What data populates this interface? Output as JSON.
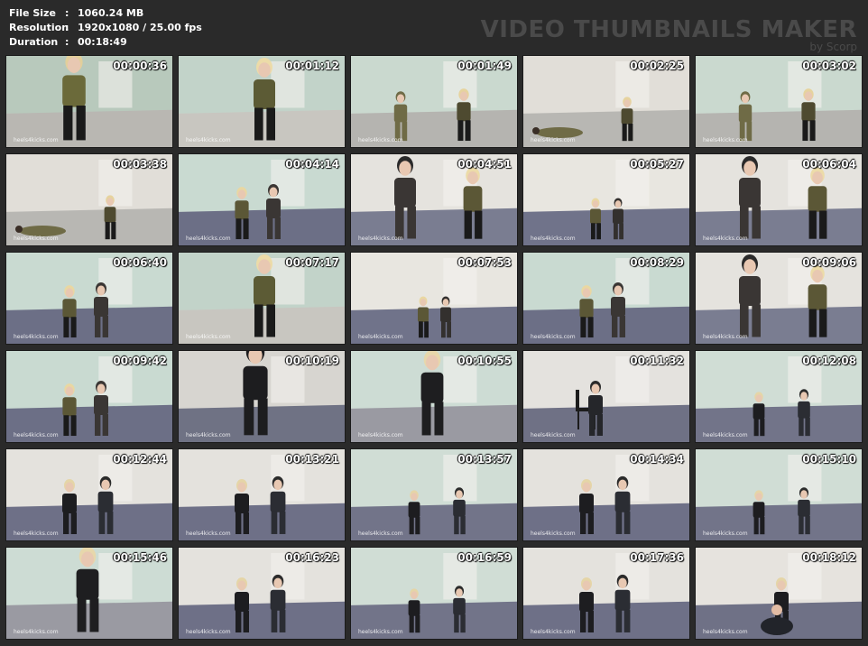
{
  "header": {
    "file_size_label": "File Size",
    "file_size_value": "1060.24 MB",
    "resolution_label": "Resolution",
    "resolution_value": "1920x1080 / 25.00 fps",
    "duration_label": "Duration",
    "duration_value": "00:18:49",
    "separator": ":",
    "brand_title": "VIDEO THUMBNAILS MAKER",
    "brand_sub": "by Scorp"
  },
  "watermark": "heels4kicks.com",
  "thumbnails": [
    {
      "time": "00:00:36",
      "scene": "camo-close"
    },
    {
      "time": "00:01:12",
      "scene": "camo-portrait"
    },
    {
      "time": "00:01:49",
      "scene": "camo-two"
    },
    {
      "time": "00:02:25",
      "scene": "camo-floor"
    },
    {
      "time": "00:03:02",
      "scene": "camo-two"
    },
    {
      "time": "00:03:38",
      "scene": "camo-floor"
    },
    {
      "time": "00:04:14",
      "scene": "suit-two"
    },
    {
      "time": "00:04:51",
      "scene": "suit-close"
    },
    {
      "time": "00:05:27",
      "scene": "suit-far"
    },
    {
      "time": "00:06:04",
      "scene": "suit-close"
    },
    {
      "time": "00:06:40",
      "scene": "suit-two"
    },
    {
      "time": "00:07:17",
      "scene": "camo-portrait"
    },
    {
      "time": "00:07:53",
      "scene": "suit-far"
    },
    {
      "time": "00:08:29",
      "scene": "suit-two"
    },
    {
      "time": "00:09:06",
      "scene": "suit-close"
    },
    {
      "time": "00:09:42",
      "scene": "suit-two"
    },
    {
      "time": "00:10:19",
      "scene": "boots"
    },
    {
      "time": "00:10:55",
      "scene": "leather-portrait"
    },
    {
      "time": "00:11:32",
      "scene": "chair"
    },
    {
      "time": "00:12:08",
      "scene": "leather-far"
    },
    {
      "time": "00:12:44",
      "scene": "leather-two"
    },
    {
      "time": "00:13:21",
      "scene": "leather-two"
    },
    {
      "time": "00:13:57",
      "scene": "leather-far"
    },
    {
      "time": "00:14:34",
      "scene": "leather-two"
    },
    {
      "time": "00:15:10",
      "scene": "leather-far"
    },
    {
      "time": "00:15:46",
      "scene": "leather-portrait"
    },
    {
      "time": "00:16:23",
      "scene": "leather-two"
    },
    {
      "time": "00:16:59",
      "scene": "leather-far"
    },
    {
      "time": "00:17:36",
      "scene": "leather-two"
    },
    {
      "time": "00:18:12",
      "scene": "kneel"
    }
  ]
}
